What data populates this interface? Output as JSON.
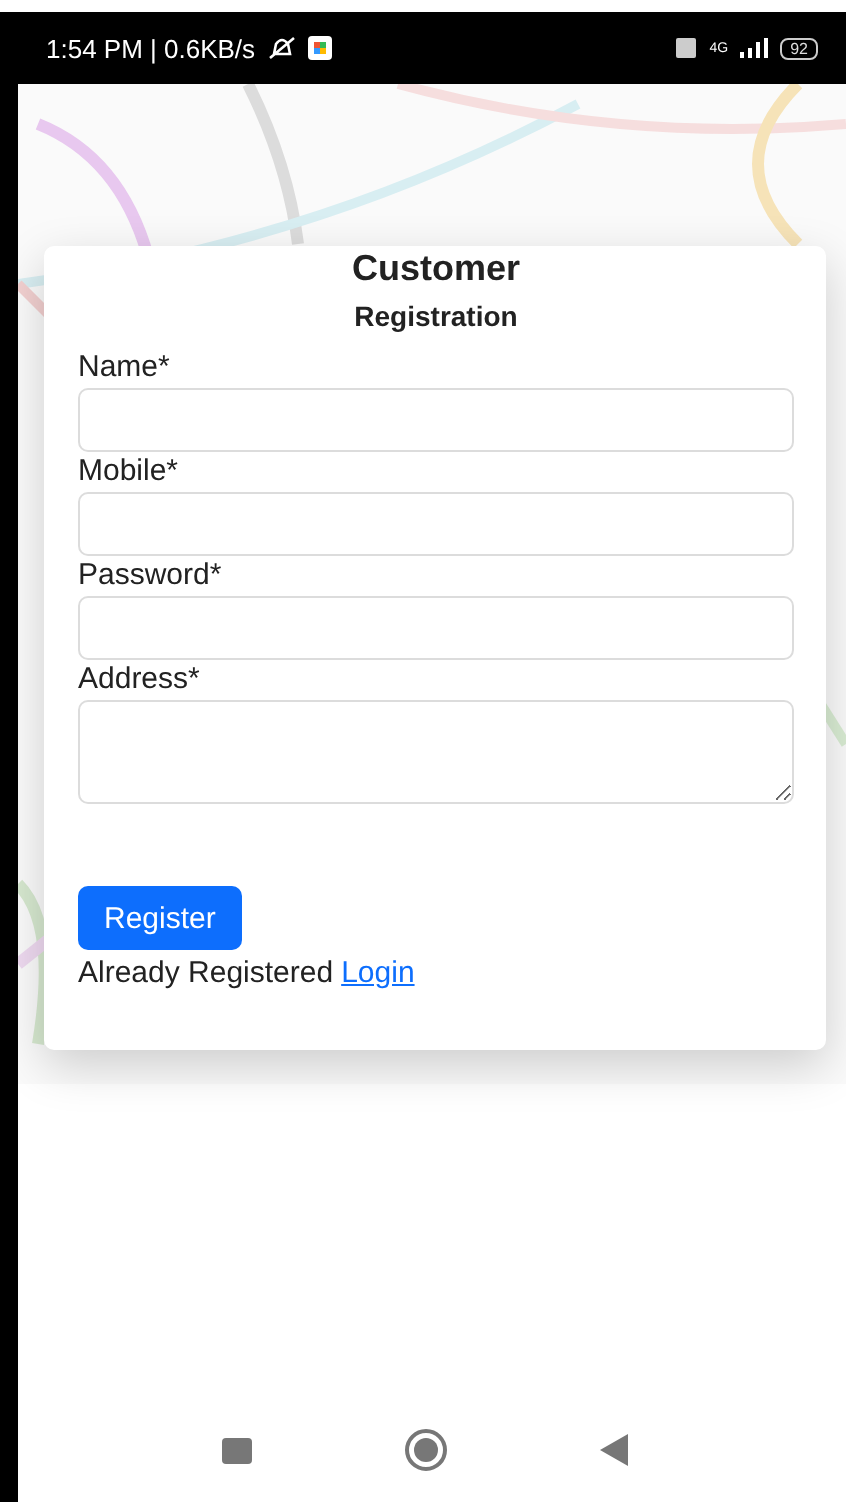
{
  "status_bar": {
    "time": "1:54 PM | 0.6KB/s",
    "network": "4G",
    "battery": "92"
  },
  "form": {
    "title": "Customer",
    "subtitle": "Registration",
    "fields": [
      {
        "label": "Name*",
        "kind": "input"
      },
      {
        "label": "Mobile*",
        "kind": "input"
      },
      {
        "label": "Password*",
        "kind": "password"
      },
      {
        "label": "Address*",
        "kind": "textarea"
      }
    ],
    "submit": "Register",
    "footer_text": "Already Registered",
    "footer_link": "Login"
  }
}
